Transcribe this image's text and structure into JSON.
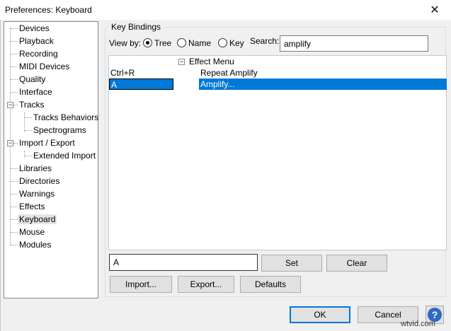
{
  "window": {
    "title": "Preferences: Keyboard",
    "close_glyph": "✕"
  },
  "tree": {
    "items": [
      {
        "label": "Devices"
      },
      {
        "label": "Playback"
      },
      {
        "label": "Recording"
      },
      {
        "label": "MIDI Devices"
      },
      {
        "label": "Quality"
      },
      {
        "label": "Interface"
      },
      {
        "label": "Tracks",
        "expander": "−"
      },
      {
        "label": "Tracks Behaviors"
      },
      {
        "label": "Spectrograms"
      },
      {
        "label": "Import / Export",
        "expander": "−"
      },
      {
        "label": "Extended Import"
      },
      {
        "label": "Libraries"
      },
      {
        "label": "Directories"
      },
      {
        "label": "Warnings"
      },
      {
        "label": "Effects"
      },
      {
        "label": "Keyboard",
        "selected": true
      },
      {
        "label": "Mouse"
      },
      {
        "label": "Modules"
      }
    ]
  },
  "key_bindings": {
    "group_title": "Key Bindings",
    "view_by_label": "View by:",
    "view_options": [
      {
        "label": "Tree",
        "checked": true
      },
      {
        "label": "Name",
        "checked": false
      },
      {
        "label": "Key",
        "checked": false
      }
    ],
    "search_label": "Search:",
    "search_value": "amplify",
    "category": {
      "expander": "−",
      "label": "Effect Menu"
    },
    "rows": [
      {
        "key": "Ctrl+R",
        "name": "Repeat Amplify",
        "selected": false
      },
      {
        "key": "A",
        "name": "Amplify...",
        "selected": true
      }
    ],
    "key_value": "A",
    "set_label": "Set",
    "clear_label": "Clear",
    "import_label": "Import...",
    "export_label": "Export...",
    "defaults_label": "Defaults"
  },
  "footer": {
    "ok_label": "OK",
    "cancel_label": "Cancel",
    "help_glyph": "?"
  },
  "watermark": "wtvid.com",
  "colors": {
    "selection": "#0078d7",
    "default_button_border": "#0078d7",
    "help_icon": "#2f6ac4"
  }
}
